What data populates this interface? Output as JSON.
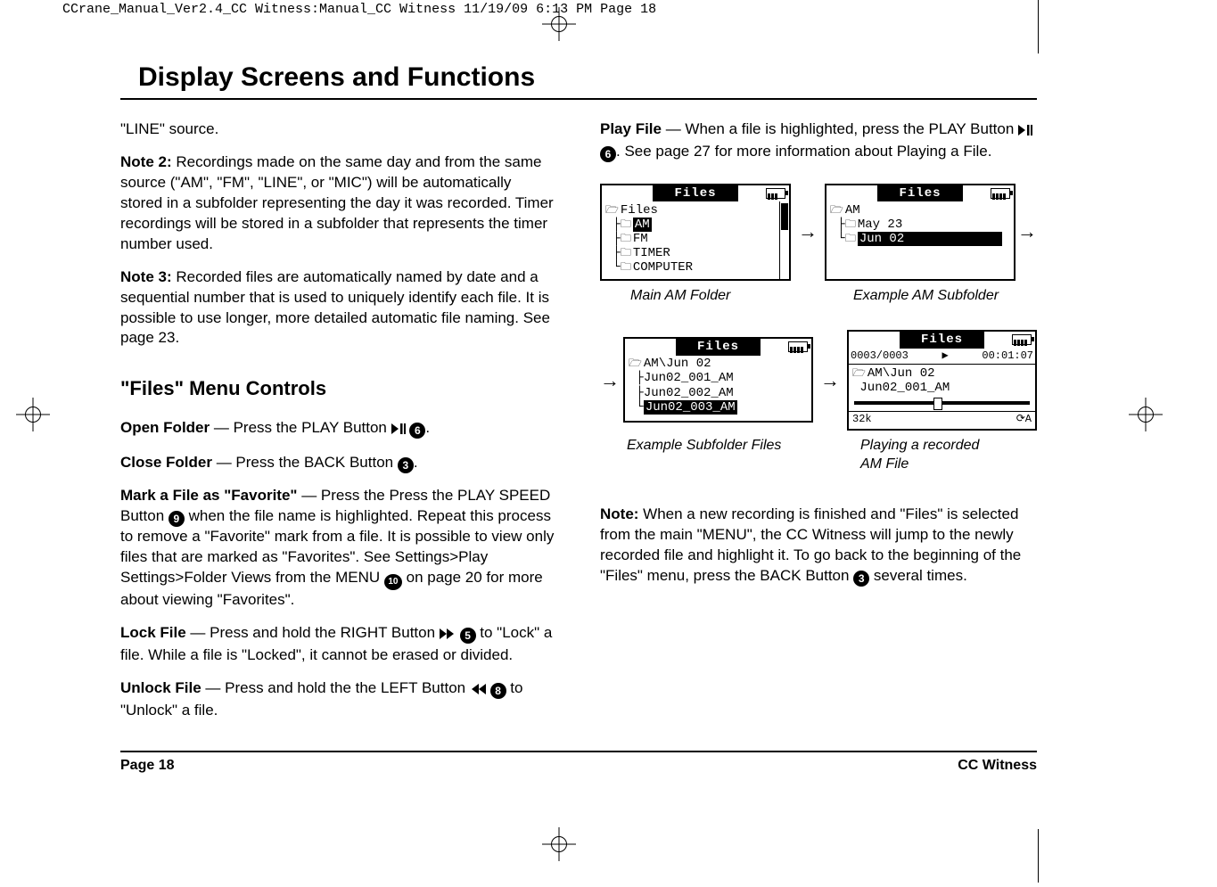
{
  "header_strip": "CCrane_Manual_Ver2.4_CC Witness:Manual_CC Witness  11/19/09  6:13 PM  Page 18",
  "title": "Display Screens and Functions",
  "left": {
    "p1": "\"LINE\" source.",
    "note2_label": "Note 2:",
    "note2_body": " Recordings made on the same day and from the same source (\"AM\", \"FM\", \"LINE\", or \"MIC\") will be automatically stored in a subfolder representing the day it was recorded. Timer recordings will be stored in a subfolder that represents the timer number used.",
    "note3_label": "Note 3:",
    "note3_body": " Recorded files are automatically named by date and a sequential number that is used to uniquely identify each file. It is possible to use longer, more detailed automatic file naming. See page 23.",
    "subhead": "\"Files\" Menu Controls",
    "open_label": "Open Folder",
    "open_body_a": " — Press the PLAY Button ",
    "open_body_b": ".",
    "close_label": "Close Folder",
    "close_body_a": " — Press the BACK Button ",
    "close_body_b": ".",
    "fav_label": "Mark a File as \"Favorite\"",
    "fav_body_a": " — Press the Press the PLAY SPEED Button ",
    "fav_body_b": " when the file name is highlighted. Repeat this process to remove a \"Favorite\" mark from a file. It is possible to view only files that are marked as \"Favorites\". See Settings>Play Settings>Folder Views from the MENU ",
    "fav_body_c": " on page 20 for more about viewing \"Favorites\".",
    "lock_label": "Lock File",
    "lock_body_a": " — Press and hold the RIGHT Button ",
    "lock_body_b": " to \"Lock\" a file. While a file is \"Locked\", it cannot be erased or divided.",
    "unlock_label": "Unlock File",
    "unlock_body_a": " — Press and hold the the LEFT Button ",
    "unlock_body_b": " to \"Unlock\" a file."
  },
  "right": {
    "play_label": "Play File",
    "play_body_a": " — When a file is highlighted, press the PLAY Button ",
    "play_body_b": ". See page 27 for more information about Playing a File.",
    "note_label": "Note:",
    "note_body": " When a new recording is finished and \"Files\" is selected from the main \"MENU\", the CC Witness will jump to the newly recorded file and highlight it. To go back to the beginning of the \"Files\" menu, press the BACK Button ",
    "note_body2": " several times."
  },
  "buttons": {
    "b3": "3",
    "b5": "5",
    "b6": "6",
    "b8": "8",
    "b9": "9",
    "b10": "10"
  },
  "lcd": {
    "files_label": "Files",
    "panel1": {
      "root": "Files",
      "items": [
        "AM",
        "FM",
        "TIMER",
        "COMPUTER"
      ],
      "highlight": "AM"
    },
    "panel2": {
      "root": "AM",
      "items": [
        "May 23",
        "Jun 02"
      ],
      "highlight": "Jun 02"
    },
    "panel3": {
      "root": "AM\\Jun 02",
      "items": [
        "Jun02_001_AM",
        "Jun02_002_AM",
        "Jun02_003_AM"
      ],
      "highlight": "Jun02_003_AM"
    },
    "panel4": {
      "counter": "0003/0003",
      "time": "00:01:07",
      "path": "AM\\Jun 02",
      "file": "Jun02_001_AM",
      "bitrate": "32k",
      "repeat": "⟳A"
    },
    "captions": {
      "c1": "Main AM Folder",
      "c2": "Example AM Subfolder",
      "c3": "Example Subfolder Files",
      "c4a": "Playing a recorded",
      "c4b": "AM File"
    }
  },
  "footer": {
    "left": "Page 18",
    "right": "CC Witness"
  }
}
